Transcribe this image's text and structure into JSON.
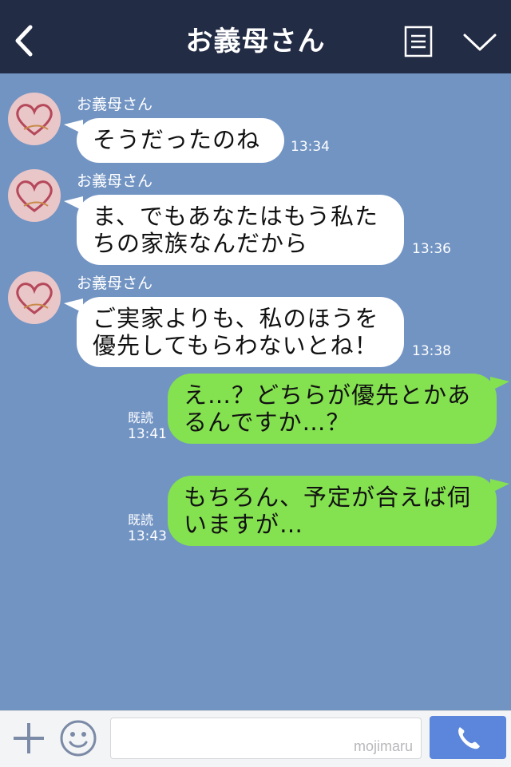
{
  "header": {
    "title": "お義母さん"
  },
  "messages": [
    {
      "sender": "お義母さん",
      "text": "そうだったのね",
      "time": "13:34"
    },
    {
      "sender": "お義母さん",
      "text": "ま、でもあなたはもう私た\nちの家族なんだから",
      "time": "13:36"
    },
    {
      "sender": "お義母さん",
      "text": "ご実家よりも、私のほうを\n優先してもらわないとね！",
      "time": "13:38"
    },
    {
      "text": "え…？どちらが優先とかあ\nるんですか…？",
      "read": "既読",
      "time": "13:41"
    },
    {
      "text": "もちろん、予定が合えば伺\nいますが…",
      "read": "既読",
      "time": "13:43"
    }
  ],
  "footer": {
    "watermark": "mojimaru"
  },
  "colors": {
    "header": "#232c45",
    "background": "#7294c3",
    "outgoing": "#84e14f",
    "incoming": "#ffffff",
    "call": "#5b86dc"
  },
  "icons": [
    "back-icon",
    "menu-icon",
    "chevron-down-icon",
    "plus-icon",
    "smile-icon",
    "phone-icon"
  ]
}
